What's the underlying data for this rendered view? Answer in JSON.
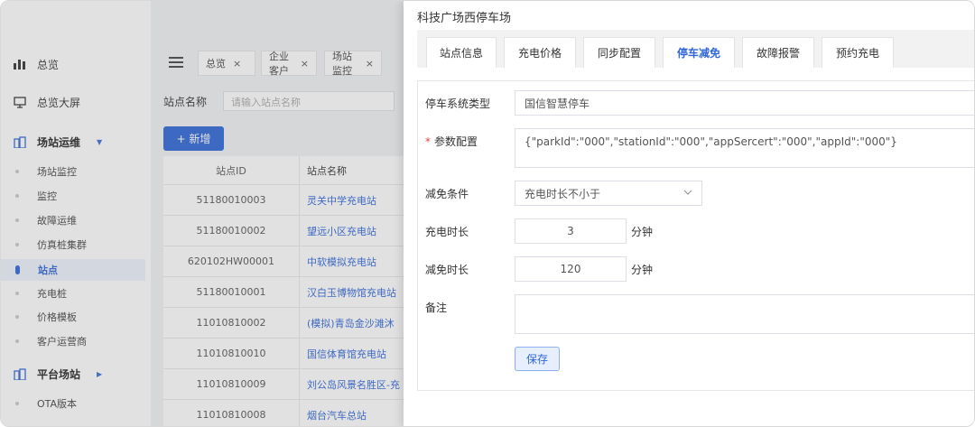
{
  "sidebar": {
    "items": [
      {
        "label": "总览",
        "icon": "bar-chart-icon"
      },
      {
        "label": "总览大屏",
        "icon": "monitor-icon"
      }
    ],
    "groups": [
      {
        "label": "场站运维",
        "icon": "building-icon",
        "arrow": "▼"
      },
      {
        "label": "平台场站",
        "icon": "building-icon",
        "arrow": "▶"
      }
    ],
    "subitems": [
      "场站监控",
      "监控",
      "故障运维",
      "仿真桩集群",
      "站点",
      "充电桩",
      "价格模板",
      "客户运营商"
    ],
    "active_subitem": "站点",
    "platform_subitems": [
      "OTA版本"
    ]
  },
  "header": {
    "tabs": [
      {
        "label": "总览",
        "close": "×"
      },
      {
        "label": "企业客户",
        "close": "×"
      },
      {
        "label": "场站监控",
        "close": "×"
      }
    ]
  },
  "search": {
    "label": "站点名称",
    "placeholder": "请输入站点名称"
  },
  "toolbar": {
    "add_label": "+ 新增"
  },
  "table": {
    "headers": [
      "站点ID",
      "站点名称"
    ],
    "rows": [
      [
        "51180010003",
        "灵关中学充电站"
      ],
      [
        "51180010002",
        "望远小区充电站"
      ],
      [
        "620102HW00001",
        "中软模拟充电站"
      ],
      [
        "51180010001",
        "汉白玉博物馆充电站"
      ],
      [
        "11010810002",
        "(模拟)青岛金沙滩沐"
      ],
      [
        "11010810010",
        "国信体育馆充电站"
      ],
      [
        "11010810009",
        "刘公岛风景名胜区-充"
      ],
      [
        "11010810008",
        "烟台汽车总站"
      ]
    ]
  },
  "drawer": {
    "title": "科技广场西停车场",
    "tabs": [
      "站点信息",
      "充电价格",
      "同步配置",
      "停车减免",
      "故障报警",
      "预约充电"
    ],
    "active_tab": "停车减免",
    "form": {
      "parking_type_label": "停车系统类型",
      "parking_type_value": "国信智慧停车",
      "params_required": "*",
      "params_label": "参数配置",
      "params_value": "{\"parkId\":\"000\",\"stationId\":\"000\",\"appSercert\":\"000\",\"appId\":\"000\"}",
      "condition_label": "减免条件",
      "condition_value": "充电时长不小于",
      "charge_duration_label": "充电时长",
      "charge_duration_value": "3",
      "charge_duration_unit": "分钟",
      "reduce_duration_label": "减免时长",
      "reduce_duration_value": "120",
      "reduce_duration_unit": "分钟",
      "remark_label": "备注",
      "remark_value": "",
      "save_label": "保存"
    }
  },
  "colors": {
    "accent": "#2f66d8",
    "required": "#e14545",
    "overlay": "#787878"
  }
}
